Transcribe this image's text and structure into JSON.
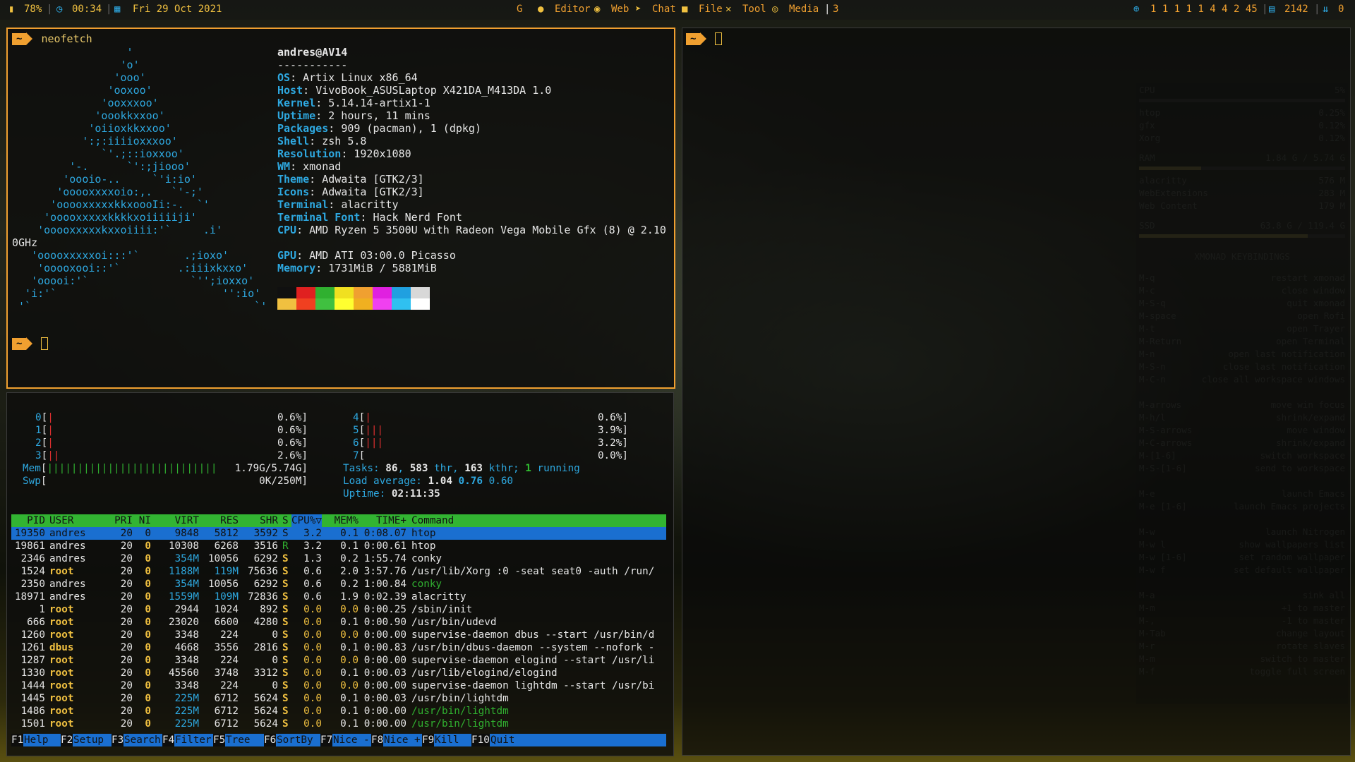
{
  "statusbar": {
    "battery": "78%",
    "clock": "00:34",
    "date": "Fri 29 Oct 2021",
    "layout_letter": "G",
    "workspaces": [
      "Editor",
      "Web",
      "Chat",
      "File",
      "Tool",
      "Media"
    ],
    "layout_sep": "|",
    "window_count": "3",
    "net_stats": "1 1 1 1 1 4 4 2 45",
    "memory_used": "2142",
    "updates": "0",
    "icons": [
      "battery-icon",
      "clock-icon",
      "calendar-icon",
      "github-icon",
      "firefox-icon",
      "telegram-icon",
      "folder-icon",
      "tools-icon",
      "media-icon",
      "globe-icon",
      "memory-icon",
      "download-icon"
    ]
  },
  "terminal_left": {
    "prompt_symbol": "~",
    "command": "neofetch",
    "logo_lines": [
      "                  '",
      "                 'o'",
      "                'ooo'",
      "               'ooxoo'",
      "              'ooxxxoo'",
      "             'oookkxxoo'",
      "            'oiioxkkxxoo'",
      "           ':;:iiiioxxxoo'",
      "              `'.;::ioxxoo'",
      "         '-.      `':;jiooo'",
      "        'oooio-..     `'i:io'",
      "       'ooooxxxxoio:,.   `'-;'",
      "      'ooooxxxxxkkxoooIi:-.  `'",
      "     'ooooxxxxxkkkkxoiiiiiji'",
      "    'ooooxxxxxkxxoiiii:'`     .i'",
      "0GHz",
      "   'ooooxxxxxoi:::'`       .;ioxo'",
      "    'ooooxooi::'`         .:iiixkxxo'",
      "   'ooooi:'`                `'';ioxxo'",
      "  'i:'`                          '':io'",
      " '`                                   `'"
    ],
    "user_host": "andres@AV14",
    "separator": "-----------",
    "info": [
      {
        "key": "OS",
        "value": "Artix Linux x86_64"
      },
      {
        "key": "Host",
        "value": "VivoBook_ASUSLaptop X421DA_M413DA 1.0"
      },
      {
        "key": "Kernel",
        "value": "5.14.14-artix1-1"
      },
      {
        "key": "Uptime",
        "value": "2 hours, 11 mins"
      },
      {
        "key": "Packages",
        "value": "909 (pacman), 1 (dpkg)"
      },
      {
        "key": "Shell",
        "value": "zsh 5.8"
      },
      {
        "key": "Resolution",
        "value": "1920x1080"
      },
      {
        "key": "WM",
        "value": "xmonad"
      },
      {
        "key": "Theme",
        "value": "Adwaita [GTK2/3]"
      },
      {
        "key": "Icons",
        "value": "Adwaita [GTK2/3]"
      },
      {
        "key": "Terminal",
        "value": "alacritty"
      },
      {
        "key": "Terminal Font",
        "value": "Hack Nerd Font"
      },
      {
        "key": "CPU",
        "value": "AMD Ryzen 5 3500U with Radeon Vega Mobile Gfx (8) @ 2.10"
      },
      {
        "key": "GPU",
        "value": "AMD ATI 03:00.0 Picasso"
      },
      {
        "key": "Memory",
        "value": "1731MiB / 5881MiB"
      }
    ],
    "palette_top": [
      "#101010",
      "#e02020",
      "#30b030",
      "#f0e020",
      "#f0a030",
      "#e020e0",
      "#20a0e0",
      "#d8d8d8"
    ],
    "palette_bottom": [
      "#f0c040",
      "#f04020",
      "#40c040",
      "#ffff30",
      "#f0b020",
      "#f040f0",
      "#30c0f0",
      "#ffffff"
    ]
  },
  "terminal_right": {
    "prompt_symbol": "~"
  },
  "htop": {
    "cpus": [
      {
        "id": "0",
        "bars": "|",
        "pct": "0.6%]"
      },
      {
        "id": "1",
        "bars": "|",
        "pct": "0.6%]"
      },
      {
        "id": "2",
        "bars": "|",
        "pct": "0.6%]"
      },
      {
        "id": "3",
        "bars": "||",
        "pct": "2.6%]"
      },
      {
        "id": "4",
        "bars": "|",
        "pct": "0.6%]"
      },
      {
        "id": "5",
        "bars": "|||",
        "pct": "3.9%]"
      },
      {
        "id": "6",
        "bars": "|||",
        "pct": "3.2%]"
      },
      {
        "id": "7",
        "bars": "",
        "pct": "0.0%]"
      }
    ],
    "mem_label": "Mem",
    "mem_bars": "||||||||||||||||||||||||||||",
    "mem_value": "1.79G/5.74G]",
    "swp_label": "Swp",
    "swp_value": "0K/250M]",
    "tasks_label": "Tasks:",
    "tasks": "86",
    "thr": "583",
    "thr_label": "thr,",
    "kthr": "163",
    "kthr_label": "kthr;",
    "running": "1",
    "running_label": "running",
    "load_label": "Load average:",
    "load1": "1.04",
    "load5": "0.76",
    "load15": "0.60",
    "uptime_label": "Uptime:",
    "uptime": "02:11:35",
    "columns": [
      "PID",
      "USER",
      "PRI",
      "NI",
      "VIRT",
      "RES",
      "SHR",
      "S",
      "CPU%▽",
      "MEM%",
      "TIME+",
      "Command"
    ],
    "processes": [
      {
        "pid": "19350",
        "user": "andres",
        "pri": "20",
        "ni": "0",
        "virt": "9848",
        "res": "5812",
        "shr": "3592",
        "s": "S",
        "cpu": "3.2",
        "mem": "0.1",
        "time": "0:08.07",
        "cmd": "htop"
      },
      {
        "pid": "19861",
        "user": "andres",
        "pri": "20",
        "ni": "0",
        "virt": "10308",
        "res": "6268",
        "shr": "3516",
        "s": "R",
        "cpu": "3.2",
        "mem": "0.1",
        "time": "0:00.61",
        "cmd": "htop"
      },
      {
        "pid": "2346",
        "user": "andres",
        "pri": "20",
        "ni": "0",
        "virt": "354M",
        "res": "10056",
        "shr": "6292",
        "s": "S",
        "cpu": "1.3",
        "mem": "0.2",
        "time": "1:55.74",
        "cmd": "conky"
      },
      {
        "pid": "1524",
        "user": "root",
        "pri": "20",
        "ni": "0",
        "virt": "1188M",
        "res": "119M",
        "shr": "75636",
        "s": "S",
        "cpu": "0.6",
        "mem": "2.0",
        "time": "3:57.76",
        "cmd": "/usr/lib/Xorg :0 -seat seat0 -auth /run/"
      },
      {
        "pid": "2350",
        "user": "andres",
        "pri": "20",
        "ni": "0",
        "virt": "354M",
        "res": "10056",
        "shr": "6292",
        "s": "S",
        "cpu": "0.6",
        "mem": "0.2",
        "time": "1:00.84",
        "cmd": "conky"
      },
      {
        "pid": "18971",
        "user": "andres",
        "pri": "20",
        "ni": "0",
        "virt": "1559M",
        "res": "109M",
        "shr": "72836",
        "s": "S",
        "cpu": "0.6",
        "mem": "1.9",
        "time": "0:02.39",
        "cmd": "alacritty"
      },
      {
        "pid": "1",
        "user": "root",
        "pri": "20",
        "ni": "0",
        "virt": "2944",
        "res": "1024",
        "shr": "892",
        "s": "S",
        "cpu": "0.0",
        "mem": "0.0",
        "time": "0:00.25",
        "cmd": "/sbin/init"
      },
      {
        "pid": "666",
        "user": "root",
        "pri": "20",
        "ni": "0",
        "virt": "23020",
        "res": "6600",
        "shr": "4280",
        "s": "S",
        "cpu": "0.0",
        "mem": "0.1",
        "time": "0:00.90",
        "cmd": "/usr/bin/udevd"
      },
      {
        "pid": "1260",
        "user": "root",
        "pri": "20",
        "ni": "0",
        "virt": "3348",
        "res": "224",
        "shr": "0",
        "s": "S",
        "cpu": "0.0",
        "mem": "0.0",
        "time": "0:00.00",
        "cmd": "supervise-daemon dbus --start /usr/bin/d"
      },
      {
        "pid": "1261",
        "user": "dbus",
        "pri": "20",
        "ni": "0",
        "virt": "4668",
        "res": "3556",
        "shr": "2816",
        "s": "S",
        "cpu": "0.0",
        "mem": "0.1",
        "time": "0:00.83",
        "cmd": "/usr/bin/dbus-daemon --system --nofork -"
      },
      {
        "pid": "1287",
        "user": "root",
        "pri": "20",
        "ni": "0",
        "virt": "3348",
        "res": "224",
        "shr": "0",
        "s": "S",
        "cpu": "0.0",
        "mem": "0.0",
        "time": "0:00.00",
        "cmd": "supervise-daemon elogind --start /usr/li"
      },
      {
        "pid": "1330",
        "user": "root",
        "pri": "20",
        "ni": "0",
        "virt": "45560",
        "res": "3748",
        "shr": "3312",
        "s": "S",
        "cpu": "0.0",
        "mem": "0.1",
        "time": "0:00.03",
        "cmd": "/usr/lib/elogind/elogind"
      },
      {
        "pid": "1444",
        "user": "root",
        "pri": "20",
        "ni": "0",
        "virt": "3348",
        "res": "224",
        "shr": "0",
        "s": "S",
        "cpu": "0.0",
        "mem": "0.0",
        "time": "0:00.00",
        "cmd": "supervise-daemon lightdm --start /usr/bi"
      },
      {
        "pid": "1445",
        "user": "root",
        "pri": "20",
        "ni": "0",
        "virt": "225M",
        "res": "6712",
        "shr": "5624",
        "s": "S",
        "cpu": "0.0",
        "mem": "0.1",
        "time": "0:00.03",
        "cmd": "/usr/bin/lightdm"
      },
      {
        "pid": "1486",
        "user": "root",
        "pri": "20",
        "ni": "0",
        "virt": "225M",
        "res": "6712",
        "shr": "5624",
        "s": "S",
        "cpu": "0.0",
        "mem": "0.1",
        "time": "0:00.00",
        "cmd": "/usr/bin/lightdm"
      },
      {
        "pid": "1501",
        "user": "root",
        "pri": "20",
        "ni": "0",
        "virt": "225M",
        "res": "6712",
        "shr": "5624",
        "s": "S",
        "cpu": "0.0",
        "mem": "0.1",
        "time": "0:00.00",
        "cmd": "/usr/bin/lightdm"
      }
    ],
    "fkeys": [
      {
        "key": "F1",
        "label": "Help"
      },
      {
        "key": "F2",
        "label": "Setup"
      },
      {
        "key": "F3",
        "label": "Search"
      },
      {
        "key": "F4",
        "label": "Filter"
      },
      {
        "key": "F5",
        "label": "Tree"
      },
      {
        "key": "F6",
        "label": "SortBy"
      },
      {
        "key": "F7",
        "label": "Nice -"
      },
      {
        "key": "F8",
        "label": "Nice +"
      },
      {
        "key": "F9",
        "label": "Kill"
      },
      {
        "key": "F10",
        "label": "Quit"
      }
    ]
  },
  "conky": {
    "cpu_label": "CPU",
    "cpu_value": "5%",
    "top_cpu": [
      {
        "name": "htop",
        "value": "0.25%"
      },
      {
        "name": "gfx",
        "value": "0.12%"
      },
      {
        "name": "Xorg",
        "value": "0.12%"
      }
    ],
    "ram_label": "RAM",
    "ram_value": "1.84 G / 5.74 G",
    "ram_fill": 0.3,
    "top_mem": [
      {
        "name": "alacritty",
        "value": "576 M"
      },
      {
        "name": "WebExtensions",
        "value": "283 M"
      },
      {
        "name": "Web Content",
        "value": "179 M"
      }
    ],
    "ssd_label": "SSD",
    "ssd_value": "63.8 G / 119.4 G",
    "ssd_fill": 0.82,
    "keybindings_title": "XMONAD KEYBINDINGS",
    "bindings": [
      {
        "key": "M-q",
        "desc": "restart xmonad"
      },
      {
        "key": "M-c",
        "desc": "close window"
      },
      {
        "key": "M-S-q",
        "desc": "quit xmonad"
      },
      {
        "key": "M-space",
        "desc": "open Rofi"
      },
      {
        "key": "M-t",
        "desc": "open Trayer"
      },
      {
        "key": "M-Return",
        "desc": "open Terminal"
      },
      {
        "key": "M-n",
        "desc": "open last notification"
      },
      {
        "key": "M-S-n",
        "desc": "close last notification"
      },
      {
        "key": "M-C-n",
        "desc": "close all workspace windows"
      },
      {
        "key": "M-arrows",
        "desc": "move win focus"
      },
      {
        "key": "M-h/l",
        "desc": "shrink/expand"
      },
      {
        "key": "M-S-arrows",
        "desc": "move window"
      },
      {
        "key": "M-C-arrows",
        "desc": "shrink/expand"
      },
      {
        "key": "M-[1-6]",
        "desc": "switch workspace"
      },
      {
        "key": "M-S-[1-6]",
        "desc": "send to workspace"
      },
      {
        "key": "M-e",
        "desc": "launch Emacs"
      },
      {
        "key": "M-e [1-6]",
        "desc": "launch Emacs projects"
      },
      {
        "key": "M-w",
        "desc": "launch Nitrogen"
      },
      {
        "key": "M-w l",
        "desc": "show wallpapers list"
      },
      {
        "key": "M-w [1-6]",
        "desc": "set random wallpaper"
      },
      {
        "key": "M-w f",
        "desc": "set default wallpaper"
      },
      {
        "key": "M-a",
        "desc": "sink all"
      },
      {
        "key": "M-m",
        "desc": "+1 to master"
      },
      {
        "key": "M-,",
        "desc": "-1 to master"
      },
      {
        "key": "M-Tab",
        "desc": "change layout"
      },
      {
        "key": "M-r",
        "desc": "rotate slaves"
      },
      {
        "key": "M-m",
        "desc": "switch to master"
      },
      {
        "key": "M-f",
        "desc": "toggle full screen"
      }
    ]
  }
}
